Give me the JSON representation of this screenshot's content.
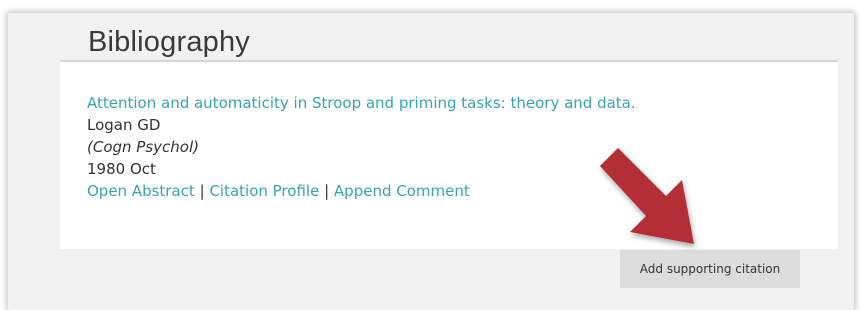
{
  "bibliography": {
    "heading": "Bibliography",
    "entries": [
      {
        "title": "Attention and automaticity in Stroop and priming tasks: theory and data.",
        "authors": "Logan GD",
        "journal": "(Cogn Psychol)",
        "date": "1980 Oct",
        "actions": {
          "open_abstract": "Open Abstract",
          "citation_profile": "Citation Profile",
          "append_comment": "Append Comment",
          "separator": "|"
        }
      }
    ],
    "add_supporting_citation_label": "Add supporting citation"
  },
  "colors": {
    "link": "#37a3b8",
    "arrow": "#b42d34",
    "panel_background": "#f1f1f1",
    "button_background": "#dcdcdc"
  },
  "icons": {
    "annotation_arrow": "arrow-down-right-icon"
  }
}
